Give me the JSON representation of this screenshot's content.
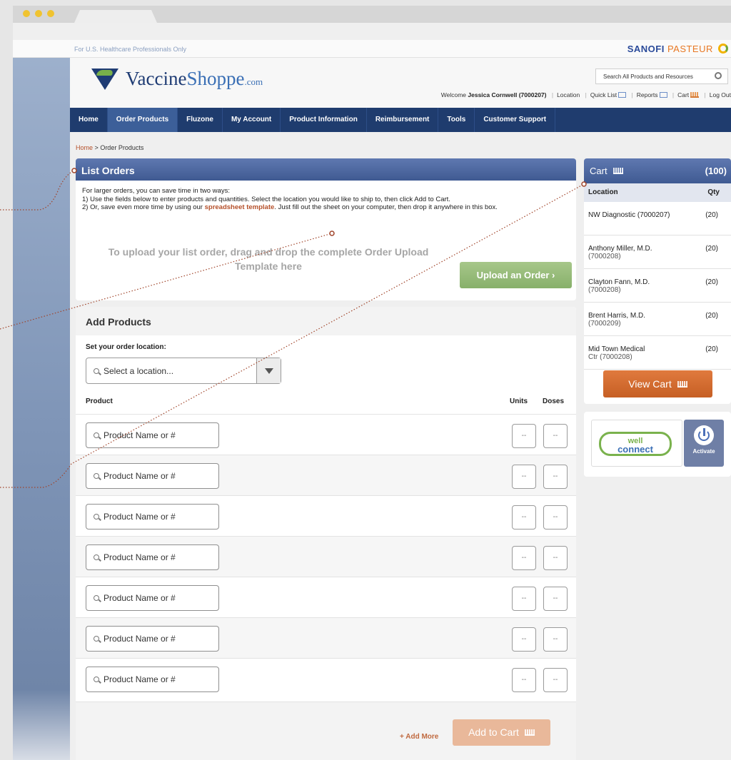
{
  "top": {
    "hcp_notice": "For U.S. Healthcare Professionals Only",
    "brand_main": "SANOFI",
    "brand_accent": "PASTEUR"
  },
  "header": {
    "logo_a": "Vaccine",
    "logo_b": "Shoppe",
    "logo_c": ".com",
    "search_placeholder": "Search All Products and Resources",
    "welcome_prefix": "Welcome",
    "user": "Jessica Cornwell (7000207)",
    "links": {
      "location": "Location",
      "quick_list": "Quick List",
      "reports": "Reports",
      "cart": "Cart",
      "logout": "Log Out"
    }
  },
  "nav": {
    "items": [
      "Home",
      "Order Products",
      "Fluzone",
      "My Account",
      "Product Information",
      "Reimbursement",
      "Tools",
      "Customer Support"
    ],
    "active": "Order Products"
  },
  "breadcrumb": {
    "home": "Home",
    "sep": ">",
    "current": "Order Products"
  },
  "list_orders": {
    "title": "List Orders",
    "line1": "For larger orders, you can save time in two ways:",
    "line2": "1) Use the fields below to enter products and quantities. Select the location you would like to ship to, then click Add to Cart.",
    "line3a": "2) Or, save even more time by using our ",
    "line3_link": "spreadsheet template",
    "line3b": ". Just fill out the sheet on your computer, then drop it anywhere in this box.",
    "drop_hint": "To upload your list order, drag and drop the complete Order Upload Template here",
    "upload_button": "Upload an Order ›"
  },
  "add_products": {
    "title": "Add Products",
    "location_label": "Set your order location:",
    "location_placeholder": "Select a location...",
    "col_product": "Product",
    "col_units": "Units",
    "col_doses": "Doses",
    "rows": [
      {
        "product": "Product Name or #",
        "units": "--",
        "doses": "--"
      },
      {
        "product": "Product Name or #",
        "units": "--",
        "doses": "--"
      },
      {
        "product": "Product Name or #",
        "units": "--",
        "doses": "--"
      },
      {
        "product": "Product Name or #",
        "units": "--",
        "doses": "--"
      },
      {
        "product": "Product Name or #",
        "units": "--",
        "doses": "--"
      },
      {
        "product": "Product Name or #",
        "units": "--",
        "doses": "--"
      },
      {
        "product": "Product Name or #",
        "units": "--",
        "doses": "--"
      }
    ],
    "add_more": "+ Add More",
    "add_to_cart": "Add to Cart"
  },
  "cart": {
    "title": "Cart",
    "count": "(100)",
    "col_location": "Location",
    "col_qty": "Qty",
    "items": [
      {
        "line1": "NW Diagnostic (7000207)",
        "line2": "",
        "qty": "(20)"
      },
      {
        "line1": "Anthony Miller, M.D.",
        "line2": "(7000208)",
        "qty": "(20)"
      },
      {
        "line1": "Clayton Fann, M.D.",
        "line2": "(7000208)",
        "qty": "(20)"
      },
      {
        "line1": "Brent Harris, M.D.",
        "line2": "(7000209)",
        "qty": "(20)"
      },
      {
        "line1": "Mid Town Medical",
        "line2": "Ctr (7000208)",
        "qty": "(20)"
      }
    ],
    "view_cart": "View Cart"
  },
  "wellconnect": {
    "logo_top": "well",
    "logo_bottom": "connect",
    "activate": "Activate"
  },
  "colors": {
    "nav": "#1f3c6e",
    "panel_head": "#4a64a0",
    "accent_orange": "#c65f24",
    "upload_green": "#8fb573",
    "annotation": "#a0442a"
  }
}
